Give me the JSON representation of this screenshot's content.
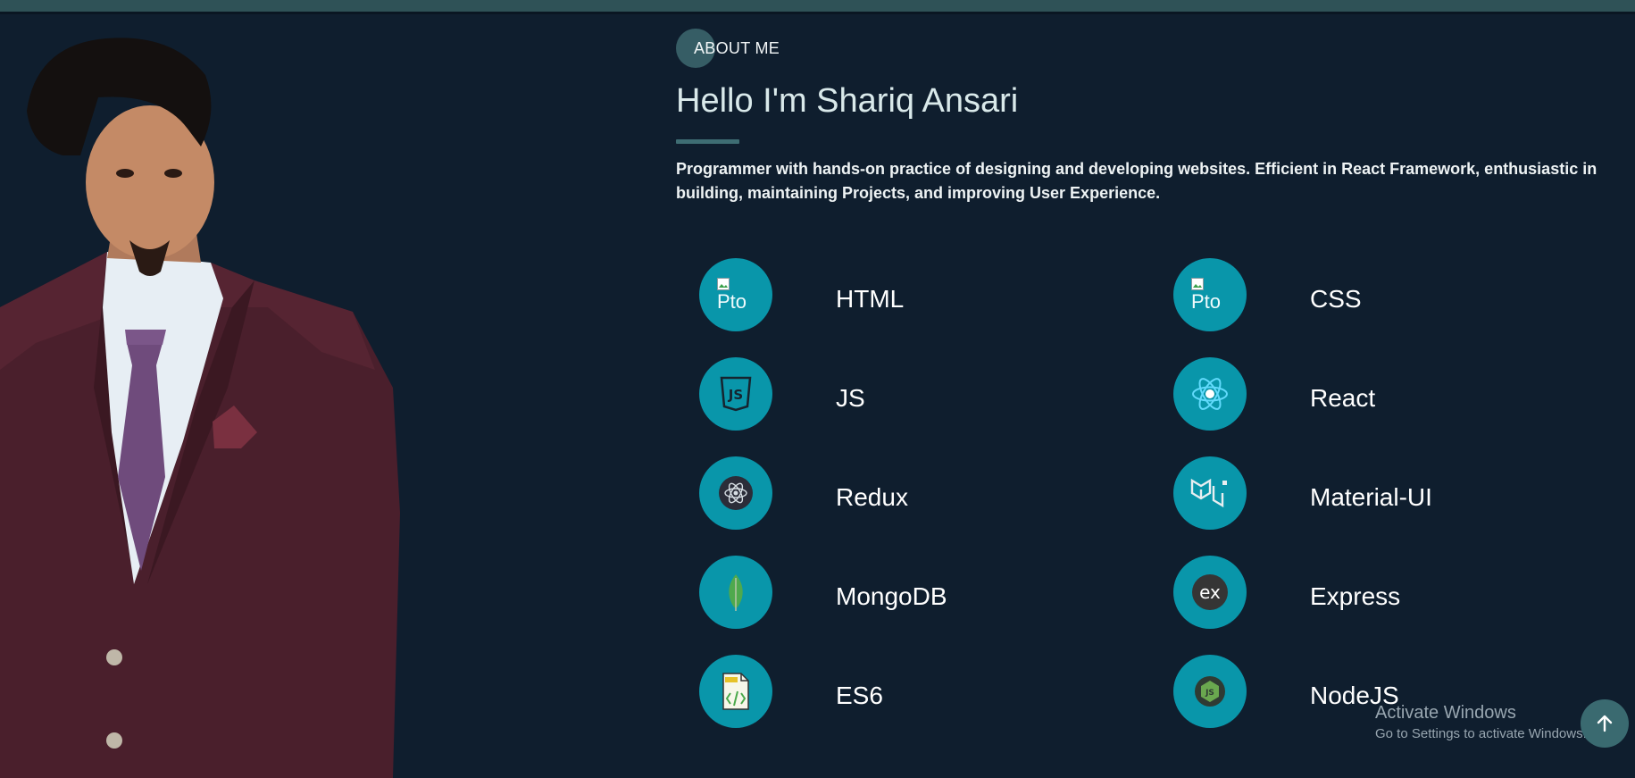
{
  "about": {
    "label": "ABOUT ME"
  },
  "hero": {
    "title": "Hello I'm Shariq Ansari",
    "description": "Programmer with hands-on practice of designing and developing websites. Efficient in React Framework, enthusiastic in building, maintaining Projects, and improving User Experience."
  },
  "skills": [
    {
      "name": "HTML",
      "icon": "broken-image-icon",
      "alt_text": "Pto"
    },
    {
      "name": "CSS",
      "icon": "broken-image-icon",
      "alt_text": "Pto"
    },
    {
      "name": "JS",
      "icon": "js-shield-icon"
    },
    {
      "name": "React",
      "icon": "react-atom-icon"
    },
    {
      "name": "Redux",
      "icon": "redux-icon"
    },
    {
      "name": "Material-UI",
      "icon": "material-ui-icon"
    },
    {
      "name": "MongoDB",
      "icon": "mongodb-leaf-icon"
    },
    {
      "name": "Express",
      "icon": "express-ex-icon",
      "icon_text": "ex"
    },
    {
      "name": "ES6",
      "icon": "es6-file-icon"
    },
    {
      "name": "NodeJS",
      "icon": "nodejs-hexagon-icon"
    }
  ],
  "watermark": {
    "line1": "Activate Windows",
    "line2": "Go to Settings to activate Windows."
  },
  "colors": {
    "background": "#0f1e2e",
    "top_bar": "#2f5257",
    "accent": "#0996aa",
    "underline": "#3e6d73",
    "scroll_button": "#3a6a70"
  }
}
